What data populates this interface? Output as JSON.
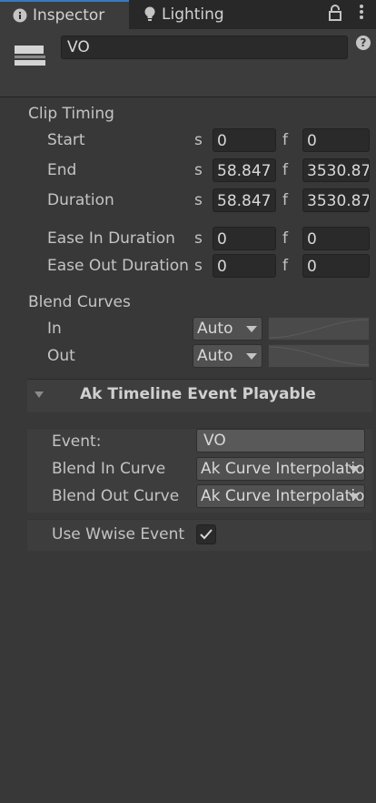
{
  "tabs": {
    "inspector": "Inspector",
    "lighting": "Lighting"
  },
  "header": {
    "name": "VO"
  },
  "clip_timing": {
    "title": "Clip Timing",
    "rows": [
      {
        "label": "Start",
        "sec_unit": "s",
        "sec_value": "0",
        "frame_unit": "f",
        "frame_value": "0"
      },
      {
        "label": "End",
        "sec_unit": "s",
        "sec_value": "58.847",
        "frame_unit": "f",
        "frame_value": "3530.87"
      },
      {
        "label": "Duration",
        "sec_unit": "s",
        "sec_value": "58.847",
        "frame_unit": "f",
        "frame_value": "3530.87"
      },
      {
        "label": "Ease In Duration",
        "sec_unit": "s",
        "sec_value": "0",
        "frame_unit": "f",
        "frame_value": "0"
      },
      {
        "label": "Ease Out Duration",
        "sec_unit": "s",
        "sec_value": "0",
        "frame_unit": "f",
        "frame_value": "0"
      }
    ]
  },
  "blend_curves": {
    "title": "Blend Curves",
    "in_label": "In",
    "in_value": "Auto",
    "out_label": "Out",
    "out_value": "Auto"
  },
  "playable": {
    "title": "Ak Timeline Event Playable",
    "event_label": "Event:",
    "event_value": "VO",
    "blend_in_label": "Blend In Curve",
    "blend_in_value": "Ak Curve Interpolation",
    "blend_out_label": "Blend Out Curve",
    "blend_out_value": "Ak Curve Interpolation",
    "use_wwise_label": "Use Wwise Event",
    "use_wwise_checked": true
  },
  "colors": {
    "panel_bg": "#383838",
    "accent_tab": "#3a79bb"
  }
}
